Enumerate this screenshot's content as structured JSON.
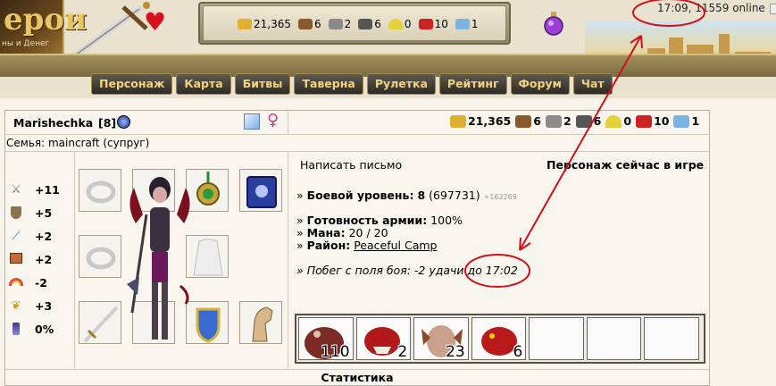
{
  "header": {
    "logo_title": "ерои",
    "logo_subtitle": "ны и Денег",
    "resources": [
      {
        "icon": "gold-icon",
        "value": "21,365",
        "color": "#e0b030"
      },
      {
        "icon": "wood-icon",
        "value": "6",
        "color": "#8a5a2a"
      },
      {
        "icon": "ore-icon",
        "value": "2",
        "color": "#8a8a8a"
      },
      {
        "icon": "mercury-icon",
        "value": "6",
        "color": "#555555"
      },
      {
        "icon": "sulfur-icon",
        "value": "0",
        "color": "#e5d23a"
      },
      {
        "icon": "crystal-icon",
        "value": "10",
        "color": "#cc2222"
      },
      {
        "icon": "gems-icon",
        "value": "1",
        "color": "#7ab4e0"
      }
    ],
    "clock": "17:09, 11559 online"
  },
  "menu": [
    "Персонаж",
    "Карта",
    "Битвы",
    "Таверна",
    "Рулетка",
    "Рейтинг",
    "Форум",
    "Чат"
  ],
  "profile": {
    "name": "Marishechka",
    "level": "[8]",
    "family": "Семья: maincraft (супруг)",
    "resources": [
      {
        "icon": "gold-icon",
        "value": "21,365",
        "color": "#e0b030"
      },
      {
        "icon": "wood-icon",
        "value": "6",
        "color": "#8a5a2a"
      },
      {
        "icon": "ore-icon",
        "value": "2",
        "color": "#8a8a8a"
      },
      {
        "icon": "mercury-icon",
        "value": "6",
        "color": "#555555"
      },
      {
        "icon": "sulfur-icon",
        "value": "0",
        "color": "#e5d23a"
      },
      {
        "icon": "crystal-icon",
        "value": "10",
        "color": "#cc2222"
      },
      {
        "icon": "gems-icon",
        "value": "1",
        "color": "#7ab4e0"
      }
    ],
    "stats": [
      {
        "icon": "attack-icon",
        "value": "+11"
      },
      {
        "icon": "defense-icon",
        "value": "+5"
      },
      {
        "icon": "spellpower-icon",
        "value": "+2"
      },
      {
        "icon": "knowledge-icon",
        "value": "+2"
      },
      {
        "icon": "luck-icon",
        "value": "-2"
      },
      {
        "icon": "morale-icon",
        "value": "+3"
      },
      {
        "icon": "initiative-icon",
        "value": "0%"
      }
    ],
    "write_letter": "Написать письмо",
    "online_status": "Персонаж сейчас в игре",
    "combat_level_label": "Боевой уровень:",
    "combat_level_value": "8",
    "combat_exp": "(697731)",
    "combat_exp_plus": "+162269",
    "army_ready_label": "Готовность армии:",
    "army_ready_value": "100%",
    "mana_label": "Мана:",
    "mana_value": "20 / 20",
    "district_label": "Район:",
    "district_value": "Peaceful Camp",
    "escape_text_prefix": "Побег с поля боя: -2 удачи до",
    "escape_time": "17:02",
    "bullet": "»",
    "army": [
      {
        "name": "unit-1",
        "count": "110",
        "color": "#7b2a24"
      },
      {
        "name": "unit-2",
        "count": "2",
        "color": "#b21a1a"
      },
      {
        "name": "unit-3",
        "count": "23",
        "color": "#8a4a2a"
      },
      {
        "name": "unit-4",
        "count": "6",
        "color": "#b81a1a"
      },
      {
        "name": "empty",
        "count": ""
      },
      {
        "name": "empty",
        "count": ""
      },
      {
        "name": "empty",
        "count": ""
      }
    ],
    "stats_tab": "Статистика"
  }
}
